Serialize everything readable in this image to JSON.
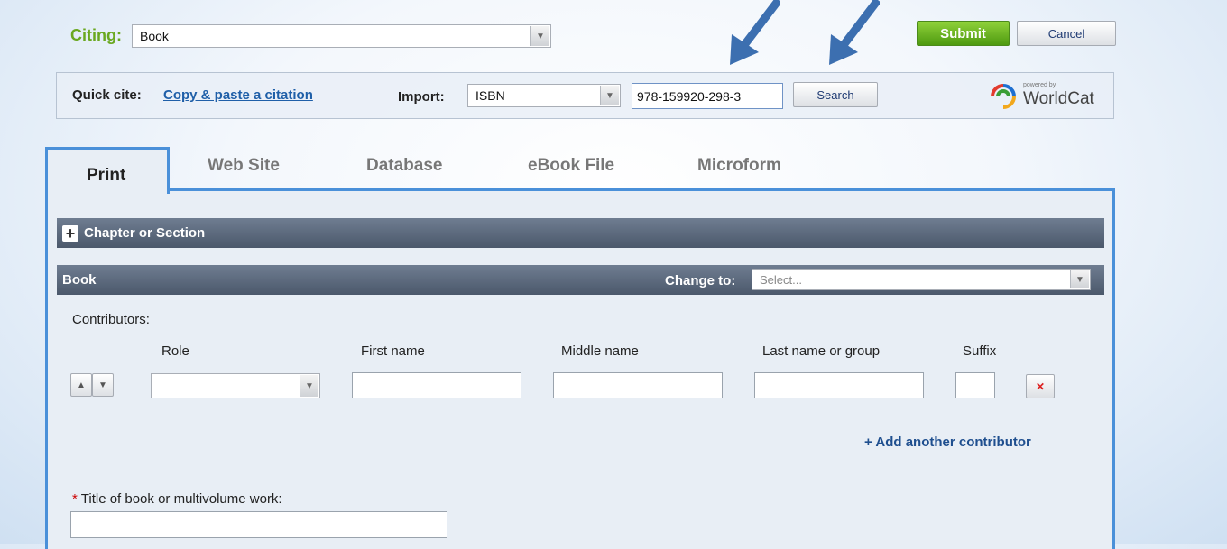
{
  "citing": {
    "label": "Citing:",
    "value": "Book"
  },
  "actions": {
    "submit": "Submit",
    "cancel": "Cancel"
  },
  "quickcite": {
    "label": "Quick cite:",
    "link": "Copy & paste a citation",
    "import_label": "Import:",
    "import_value": "ISBN",
    "isbn_value": "978-159920-298-3",
    "search": "Search",
    "powered_by": "powered by",
    "worldcat": "WorldCat"
  },
  "tabs": [
    "Print",
    "Web Site",
    "Database",
    "eBook File",
    "Microform"
  ],
  "sections": {
    "chapter": "Chapter or Section",
    "book": "Book",
    "change_to_label": "Change to:",
    "change_to_placeholder": "Select..."
  },
  "contributors": {
    "label": "Contributors:",
    "headers": {
      "role": "Role",
      "first": "First name",
      "middle": "Middle name",
      "last": "Last name or group",
      "suffix": "Suffix"
    },
    "add": "+ Add another contributor"
  },
  "title_field": {
    "required_mark": "*",
    "label": "Title of book or multivolume work:"
  },
  "colors": {
    "accent_green": "#6aa820",
    "link_blue": "#1f5fa8",
    "tab_border": "#4a90d9",
    "required_red": "#cc0000"
  }
}
